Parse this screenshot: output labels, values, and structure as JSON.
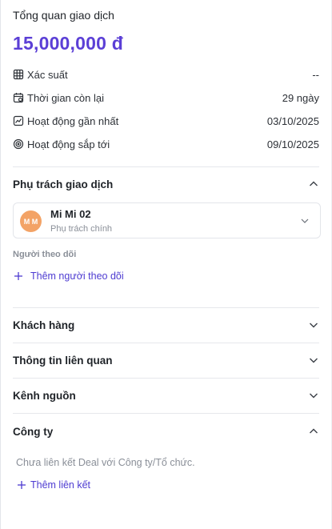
{
  "overview": {
    "title": "Tổng quan giao dịch",
    "amount": "15,000,000 đ",
    "rows": [
      {
        "label": "Xác suất",
        "value": "--",
        "icon": "table-icon"
      },
      {
        "label": "Thời gian còn lại",
        "value": "29 ngày",
        "icon": "calendar-icon"
      },
      {
        "label": "Hoạt động gần nhất",
        "value": "03/10/2025",
        "icon": "activity-chart-icon"
      },
      {
        "label": "Hoạt động sắp tới",
        "value": "09/10/2025",
        "icon": "target-icon"
      }
    ]
  },
  "owner_section": {
    "title": "Phụ trách giao dịch",
    "owner": {
      "initials": "M M",
      "name": "Mi Mi 02",
      "role": "Phụ trách chính",
      "avatar_color": "#f3a366"
    },
    "followers_label": "Người theo dõi",
    "add_follower": "Thêm người theo dõi"
  },
  "sections": {
    "customers": "Khách hàng",
    "related": "Thông tin liên quan",
    "source": "Kênh nguồn",
    "company": "Công ty"
  },
  "company": {
    "empty_text": "Chưa liên kết Deal với Công ty/Tổ chức.",
    "add_link": "Thêm liên kết"
  },
  "colors": {
    "accent": "#5b3fd6",
    "link": "#4d3bd1",
    "muted": "#8a8f98"
  }
}
